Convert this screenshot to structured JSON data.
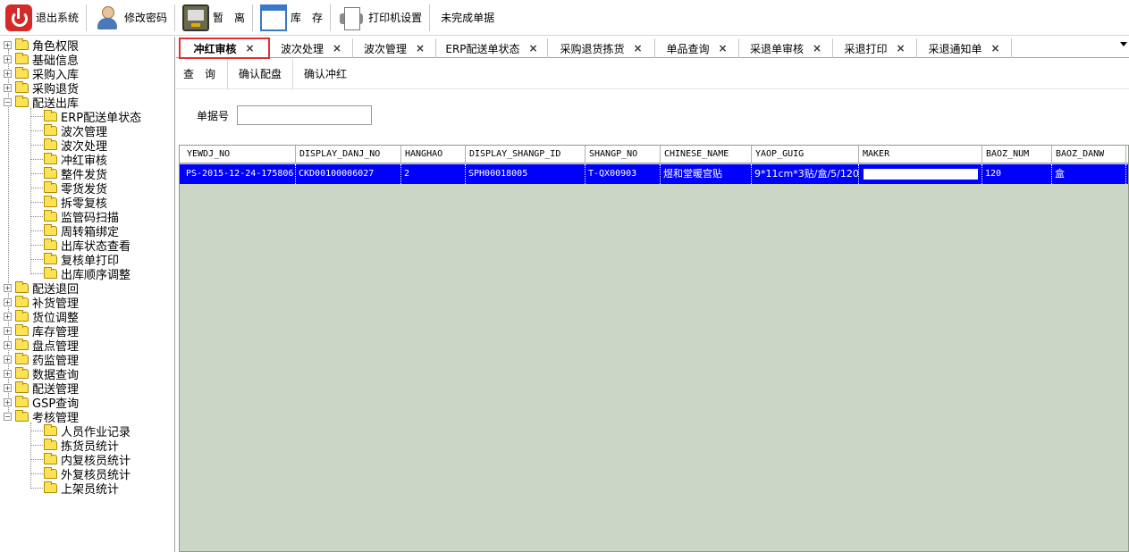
{
  "toolbar": {
    "exit": "退出系统",
    "change_password": "修改密码",
    "temp_leave": "暂　离",
    "inventory": "库　存",
    "printer_settings": "打印机设置",
    "unfinished_orders": "未完成单据"
  },
  "tree": {
    "roots": [
      {
        "label": "角色权限",
        "expanded": false
      },
      {
        "label": "基础信息",
        "expanded": false
      },
      {
        "label": "采购入库",
        "expanded": false
      },
      {
        "label": "采购退货",
        "expanded": false
      },
      {
        "label": "配送出库",
        "expanded": true,
        "children": [
          "ERP配送单状态",
          "波次管理",
          "波次处理",
          "冲红审核",
          "整件发货",
          "零货发货",
          "拆零复核",
          "监管码扫描",
          "周转箱绑定",
          "出库状态查看",
          "复核单打印",
          "出库顺序调整"
        ]
      },
      {
        "label": "配送退回",
        "expanded": false
      },
      {
        "label": "补货管理",
        "expanded": false
      },
      {
        "label": "货位调整",
        "expanded": false
      },
      {
        "label": "库存管理",
        "expanded": false
      },
      {
        "label": "盘点管理",
        "expanded": false
      },
      {
        "label": "药监管理",
        "expanded": false
      },
      {
        "label": "数据查询",
        "expanded": false
      },
      {
        "label": "配送管理",
        "expanded": false
      },
      {
        "label": "GSP查询",
        "expanded": false
      },
      {
        "label": "考核管理",
        "expanded": true,
        "children": [
          "人员作业记录",
          "拣货员统计",
          "内复核员统计",
          "外复核员统计",
          "上架员统计"
        ]
      }
    ]
  },
  "tabs": [
    {
      "label": "冲红审核",
      "active": true
    },
    {
      "label": "波次处理",
      "active": false
    },
    {
      "label": "波次管理",
      "active": false
    },
    {
      "label": "ERP配送单状态",
      "active": false
    },
    {
      "label": "采购退货拣货",
      "active": false
    },
    {
      "label": "单品查询",
      "active": false
    },
    {
      "label": "采退单审核",
      "active": false
    },
    {
      "label": "采退打印",
      "active": false
    },
    {
      "label": "采退通知单",
      "active": false
    }
  ],
  "tab_close": "×",
  "subtoolbar": {
    "query": "查　询",
    "confirm_allocation": "确认配盘",
    "confirm_red": "确认冲红"
  },
  "filter": {
    "doc_no_label": "单据号",
    "doc_no_value": ""
  },
  "grid": {
    "columns": [
      "YEWDJ_NO",
      "DISPLAY_DANJ_NO",
      "HANGHAO",
      "DISPLAY_SHANGP_ID",
      "SHANGP_NO",
      "CHINESE_NAME",
      "YAOP_GUIG",
      "MAKER",
      "BAOZ_NUM",
      "BAOZ_DANW"
    ],
    "rows": [
      [
        "PS-2015-12-24-175806",
        "CKD00100006027",
        "2",
        "SPH00018005",
        "T-QX00903",
        "煜和堂暖宫贴",
        "9*11cm*3贴/盒/5/120",
        "",
        "120",
        "盒"
      ]
    ],
    "selected_row": 0,
    "selection_color": "#0000ff",
    "background_color": "#cbd6c6"
  }
}
